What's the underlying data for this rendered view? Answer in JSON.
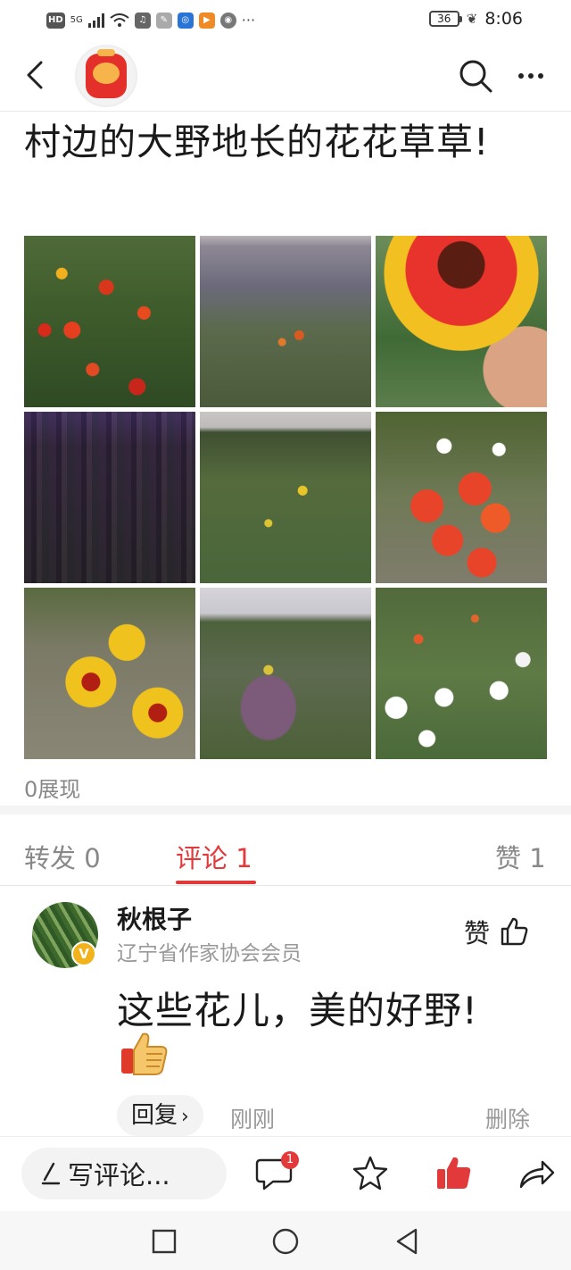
{
  "status_bar": {
    "network": "HD",
    "signal": "5G",
    "battery": "36",
    "time": "8:06"
  },
  "colors": {
    "accent": "#e2393a",
    "muted_text": "#888888",
    "divider": "#f4f4f4"
  },
  "header": {
    "back_icon": "chevron-left-icon",
    "account_avatar": "account-logo",
    "search_icon": "search-icon",
    "more_icon": "more-horizontal-icon"
  },
  "post": {
    "title": "村边的大野地长的花花草草!",
    "photos": [
      "gaillardia-field",
      "purple-grass-meadow",
      "gaillardia-in-hand",
      "purple-sage-flowers",
      "wild-field-view",
      "gaillardia-cluster",
      "yellow-red-flowers",
      "heather-field",
      "white-wildflowers"
    ],
    "views": "0展现"
  },
  "tabs": {
    "forward": "转发 0",
    "comment": "评论 1",
    "like": "赞 1"
  },
  "comment": {
    "name": "秋根子",
    "verified_badge": "V",
    "role": "辽宁省作家协会会员",
    "like_label": "赞",
    "text": "这些花儿，美的好野!",
    "reply_label": "回复",
    "reply_arrow": "›",
    "time": "刚刚",
    "delete_label": "删除"
  },
  "bottom_bar": {
    "write_label": "写评论...",
    "comment_count_badge": "1"
  }
}
